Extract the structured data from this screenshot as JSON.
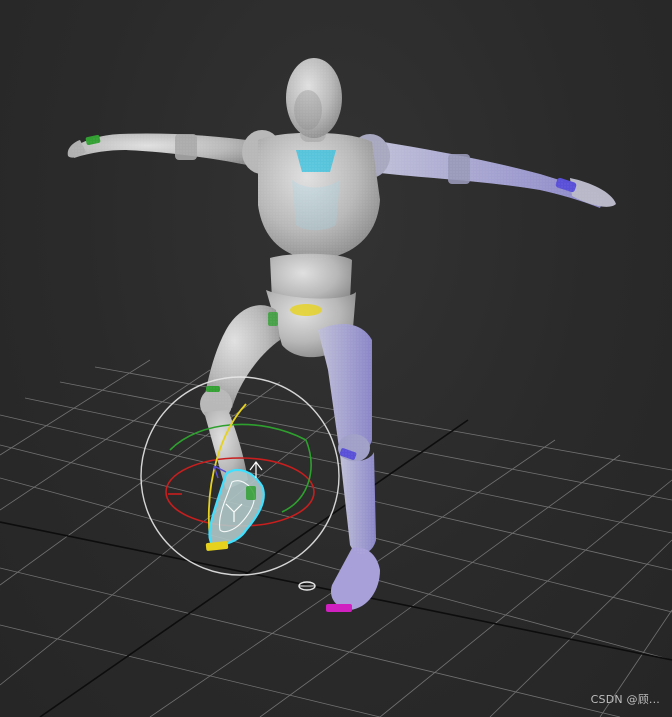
{
  "viewport": {
    "watermark": "CSDN @顾..."
  },
  "colors": {
    "background": "#2b2b2b",
    "grid_line": "#8a8a8a",
    "grid_axis": "#0d0d0d",
    "mannequin": "#c8c8c8",
    "gizmo_x": "#c81e1e",
    "gizmo_y": "#2ea02e",
    "gizmo_z": "#e6d21e",
    "gizmo_outer": "#e8e8e8",
    "selection": "#40e0ff",
    "biped_right": "#5a50d8",
    "biped_left": "#32a032",
    "biped_pelvis": "#e6d21e",
    "biped_spine": "#30c0e0",
    "biped_foot_magenta": "#d020c0"
  },
  "icons": {
    "rotate_gizmo": "rotate-gizmo-icon",
    "pivot": "pivot-icon"
  }
}
